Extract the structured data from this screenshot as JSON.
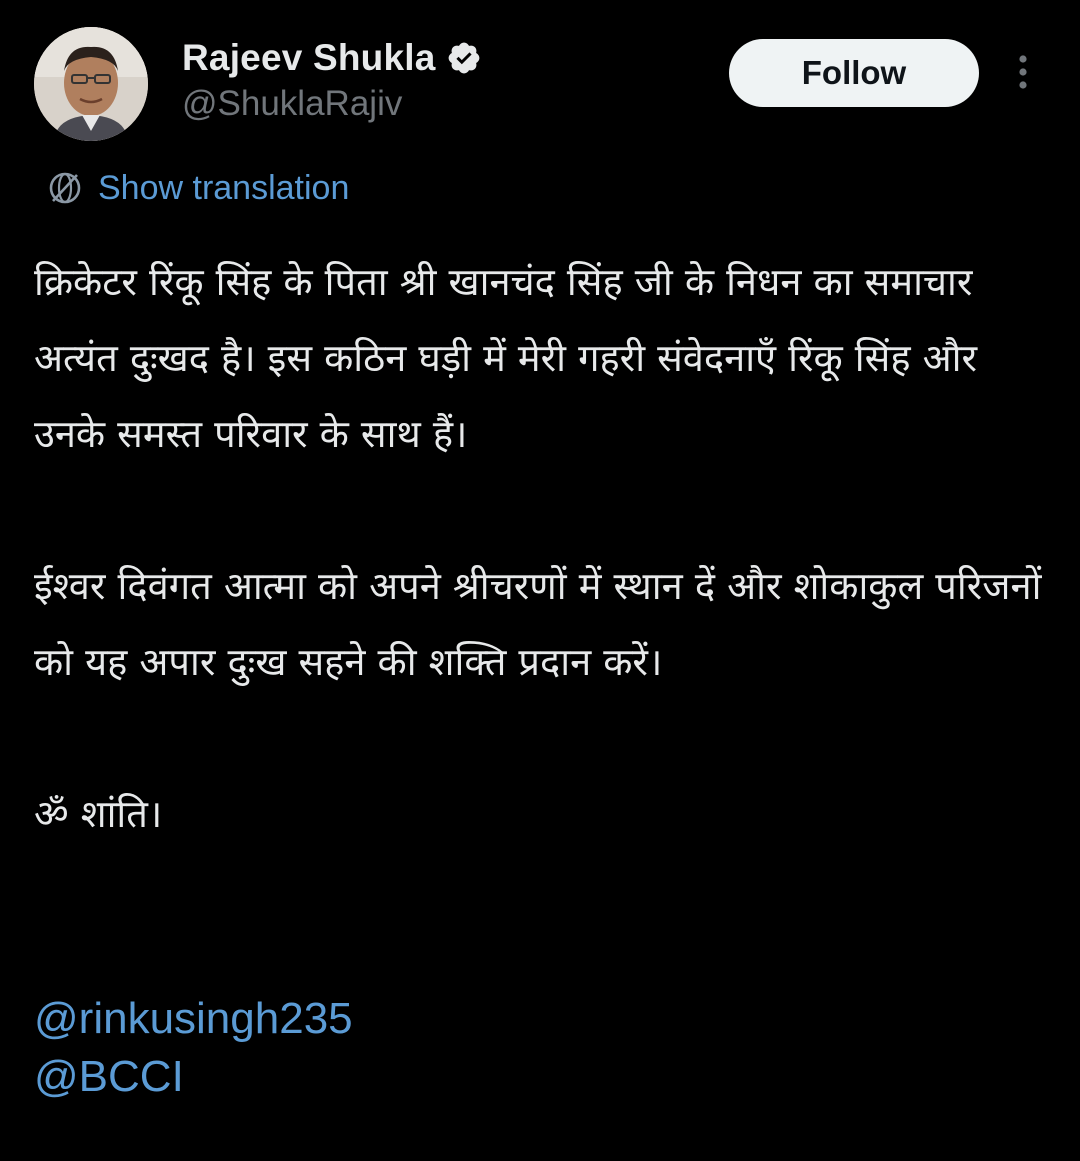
{
  "author": {
    "display_name": "Rajeev Shukla",
    "handle": "@ShuklaRajiv",
    "verified": true,
    "verified_color": "#e7e9ea"
  },
  "actions": {
    "follow_label": "Follow",
    "more_icon": "more-vertical-icon"
  },
  "translation": {
    "label": "Show translation",
    "icon": "globe-translate-icon",
    "color": "#5b9bd5"
  },
  "tweet": {
    "paragraphs": [
      "क्रिकेटर रिंकू सिंह के पिता श्री खानचंद सिंह जी के निधन का समाचार अत्यंत दुःखद है। इस कठिन घड़ी में मेरी गहरी संवेदनाएँ रिंकू सिंह और उनके समस्त परिवार के साथ हैं।",
      "ईश्वर दिवंगत आत्मा को अपने श्रीचरणों में स्थान दें और शोकाकुल परिजनों को यह अपार दुःख सहने की शक्ति प्रदान करें।",
      "ॐ शांति।"
    ],
    "mentions": [
      "@rinkusingh235",
      "@BCCI"
    ]
  },
  "colors": {
    "background": "#000000",
    "text": "#e7e9ea",
    "secondary_text": "#71767b",
    "link": "#5b9bd5",
    "follow_bg": "#eff3f4"
  }
}
